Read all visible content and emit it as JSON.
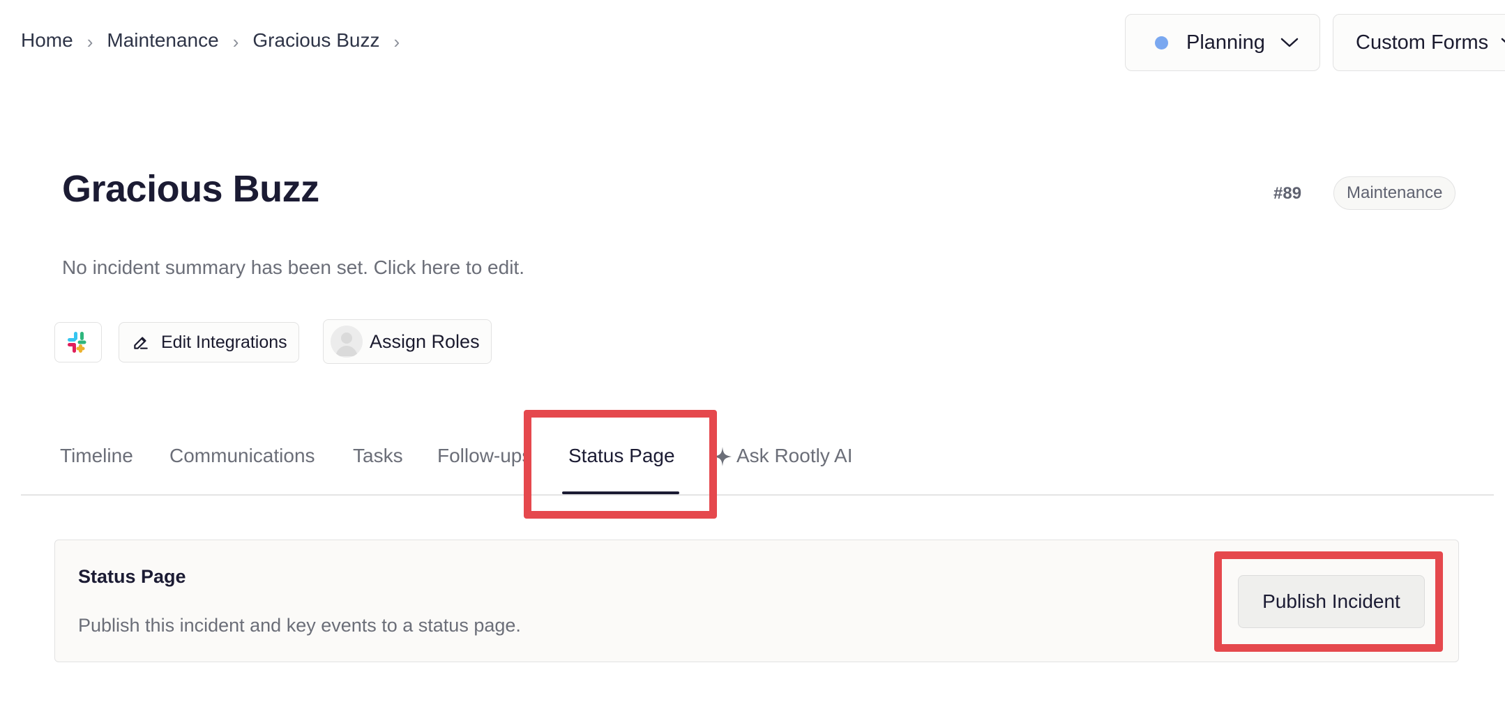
{
  "breadcrumb": {
    "items": [
      "Home",
      "Maintenance",
      "Gracious Buzz"
    ]
  },
  "header": {
    "status_label": "Planning",
    "status_color": "#7aa8f0",
    "custom_forms_label": "Custom Forms"
  },
  "incident": {
    "title": "Gracious Buzz",
    "number": "#89",
    "kind": "Maintenance",
    "summary": "No incident summary has been set. Click here to edit."
  },
  "actions": {
    "slack_icon": "slack-icon",
    "edit_integrations": "Edit Integrations",
    "assign_roles": "Assign Roles"
  },
  "tabs": [
    {
      "label": "Timeline"
    },
    {
      "label": "Communications"
    },
    {
      "label": "Tasks"
    },
    {
      "label": "Follow-ups"
    },
    {
      "label": "Status Page",
      "active": true
    },
    {
      "label": "Ask Rootly AI"
    }
  ],
  "status_panel": {
    "title": "Status Page",
    "description": "Publish this incident and key events to a status page.",
    "publish_label": "Publish Incident"
  },
  "highlight_color": "#e5484d"
}
